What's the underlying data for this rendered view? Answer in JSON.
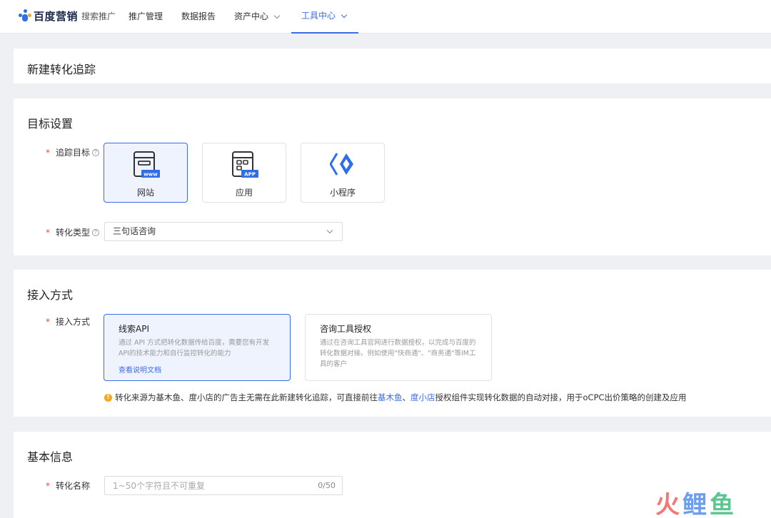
{
  "header": {
    "brand": "百度营销",
    "product": "搜索推广",
    "nav": [
      {
        "label": "推广管理"
      },
      {
        "label": "数据报告"
      },
      {
        "label": "资产中心"
      },
      {
        "label": "工具中心"
      }
    ]
  },
  "page_title": "新建转化追踪",
  "target_section": {
    "title": "目标设置",
    "track_label": "追踪目标",
    "targets": [
      {
        "label": "网站",
        "badge": "www"
      },
      {
        "label": "应用",
        "badge": "APP"
      },
      {
        "label": "小程序"
      }
    ],
    "conversion_type_label": "转化类型",
    "conversion_type_value": "三句话咨询"
  },
  "access_section": {
    "title": "接入方式",
    "label": "接入方式",
    "methods": [
      {
        "title": "线索API",
        "desc": "通过 API 方式把转化数据传给百度，需要您有开发API的技术能力和自行监控转化的能力",
        "link": "查看说明文档"
      },
      {
        "title": "咨询工具授权",
        "desc": "通过在咨询工具官网进行数据授权，以完成与百度的转化数据对接。例如使用\"快商通\"、\"商务通\"等IM工具的客户"
      }
    ],
    "notice_pre": "转化来源为基木鱼、度小店的广告主无需在此新建转化追踪，可直接前往",
    "notice_link1": "基木鱼",
    "notice_sep": "、",
    "notice_link2": "度小店",
    "notice_post": "授权组件实现转化数据的自动对接，用于oCPC出价策略的创建及应用"
  },
  "basic_section": {
    "title": "基本信息",
    "name_label": "转化名称",
    "name_placeholder": "1~50个字符且不可重复",
    "name_count": "0/50"
  },
  "colors": {
    "accent": "#3d6ce6",
    "required": "#f0483e",
    "warning": "#f5a623"
  }
}
